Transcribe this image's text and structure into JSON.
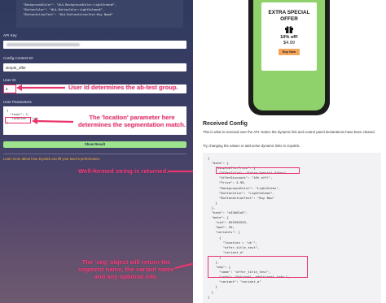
{
  "left": {
    "code_top": "  \"BackgroundColor\": \"#LA-BackgroundColor:LightGreen#\",\n  \"ButtonColor\": \"#LA-ButtonColor:LightSalmon#\",\n  \"ButtonActionText\": \"#LA-ButtonActionText:Buy Now#\"",
    "api_key_label": "API Key",
    "config_label": "Config Content ID",
    "config_value": "simple_offer",
    "user_id_label": "User ID",
    "user_id_value": "4",
    "user_params_label": "User Parameters",
    "params_code": "{\n  \"level\": 1,\n  \"location\": \"uk\"\n}",
    "show_button": "Show Result",
    "learn_link": "Learn more about how Joystick can lift your team's performance"
  },
  "annotations": {
    "user_id": "User Id determines the ab-test group.",
    "location": "The 'location' parameter here determines the segmentation match.",
    "well_formed": "Well-formed string is returned.",
    "seg": "The 'seg' object will return the segment name, the variant name and any optional info."
  },
  "preview": {
    "title": "EXTRA SPECIAL OFFER",
    "discount": "10% off!",
    "price": "$4.99",
    "button": "Buy Now",
    "colors": {
      "screen": "#8fd26b",
      "button": "#f5a55a"
    }
  },
  "right": {
    "title": "Received Config",
    "description": "This is what is received over the API. Notice the dynamic link and control panel declarations have been cleared.",
    "hint": "Try changing the values or add some dynamic links in Joystick.",
    "code": "{\n  \"data\": {\n    \"SimpleOfferPrice\": {\n      \"OfferTitle\": \"Extra Special Offer\",\n      \"OfferDiscount\": \"10% off!\",\n      \"Price\": 4.99,\n      \"BackgroundColor\": \"LightGreen\",\n      \"ButtonColor\": \"LightSalmon\",\n      \"ButtonActionText\": \"Buy Now\"\n    }\n  },\n  \"hash\": \"a33b01a5\",\n  \"meta\": {\n    \"uid\": 655595539,\n    \"mod\": 59,\n    \"variants\": [\n      {\n        \"location = 'uk'\",\n        \"offer_title_test\",\n        \"variant_a\"\n      }\n    ],\n    \"seg\": {\n      \"name\": \"offer_title_test\",\n      \"info\": \"Optional, additional info.\",\n      \"variant\": \"variant_a\"\n    }\n  }\n}"
  }
}
